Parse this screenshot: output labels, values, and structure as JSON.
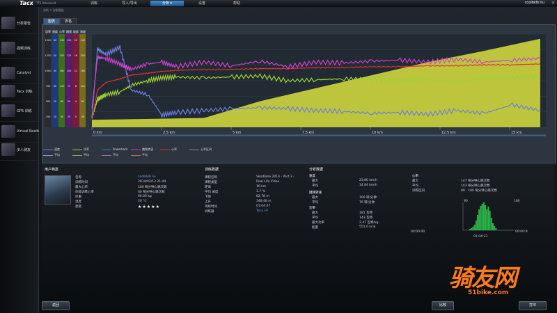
{
  "app": {
    "logo": "Tacx",
    "logo_sub": "TTS Advanced",
    "user": "coolbklb liu"
  },
  "menu": [
    {
      "label": "训练"
    },
    {
      "label": "导入/导出"
    },
    {
      "label": "分析"
    },
    {
      "label": "设置"
    },
    {
      "label": "帮助"
    }
  ],
  "sidebar": [
    {
      "label": "分析报告"
    },
    {
      "label": "视频训练"
    },
    {
      "label": "Catalyst"
    },
    {
      "label": "Tacx 训练"
    },
    {
      "label": "GPS 训练"
    },
    {
      "label": "Virtual Reality"
    },
    {
      "label": "多人骑友"
    }
  ],
  "breadcrumb": "分析 > 分析报告",
  "tabs": [
    {
      "label": "图表"
    },
    {
      "label": "表格"
    }
  ],
  "chart_data": {
    "type": "line",
    "x_ticks": [
      "0 km",
      "2.5 km",
      "5 km",
      "7.5 km",
      "10 km",
      "12.5 km",
      "15 km"
    ],
    "xlim": [
      0,
      16.2
    ],
    "y_axes": [
      {
        "name": "功率",
        "ticks": [
          "1500",
          "1250",
          "1000",
          "750",
          "500",
          "250"
        ]
      },
      {
        "name": "速度",
        "ticks": [
          "60",
          "50",
          "40",
          "30",
          "20",
          "10"
        ]
      },
      {
        "name": "心率",
        "ticks": [
          "240",
          "200",
          "160",
          "120",
          "80",
          "40"
        ]
      },
      {
        "name": "踏频",
        "ticks": [
          "150",
          "125",
          "100",
          "75",
          "50",
          "25"
        ]
      },
      {
        "name": "坡度",
        "ticks": [
          "20",
          "16",
          "12",
          "8",
          "4",
          "0"
        ]
      },
      {
        "name": "海拔",
        "ticks": [
          "240",
          "200",
          "160",
          "120",
          "80",
          "40"
        ]
      }
    ],
    "series": [
      {
        "name": "速度",
        "color": "#6b7fe0",
        "x": [
          0,
          0.2,
          0.5,
          1,
          1.4,
          2,
          2.5,
          3,
          4,
          5,
          6,
          7,
          8,
          9,
          10,
          11,
          12,
          13,
          14,
          15,
          16
        ],
        "y": [
          0.1,
          0.84,
          0.78,
          0.86,
          0.4,
          0.35,
          0.13,
          0.16,
          0.18,
          0.2,
          0.21,
          0.2,
          0.18,
          0.17,
          0.15,
          0.16,
          0.14,
          0.18,
          0.15,
          0.24,
          0.18
        ]
      },
      {
        "name": "功率",
        "color": "#9dd230",
        "x": [
          0,
          0.2,
          0.5,
          1,
          1.4,
          2,
          2.5,
          3,
          4,
          5,
          6,
          7,
          8,
          9,
          10,
          11,
          12,
          13,
          14,
          15,
          16
        ],
        "y": [
          0.1,
          0.3,
          0.35,
          0.38,
          0.45,
          0.5,
          0.53,
          0.54,
          0.53,
          0.54,
          0.55,
          0.5,
          0.51,
          0.52,
          0.52,
          0.5,
          0.51,
          0.49,
          0.52,
          0.53,
          0.55
        ]
      },
      {
        "name": "心率",
        "color": "#e03030",
        "x": [
          0,
          0.2,
          0.5,
          1,
          1.4,
          2,
          2.5,
          3,
          4,
          5,
          6,
          7,
          8,
          9,
          10,
          11,
          12,
          13,
          14,
          15,
          16
        ],
        "y": [
          0.08,
          0.4,
          0.48,
          0.52,
          0.56,
          0.58,
          0.6,
          0.61,
          0.62,
          0.62,
          0.63,
          0.63,
          0.64,
          0.64,
          0.65,
          0.65,
          0.66,
          0.66,
          0.67,
          0.67,
          0.68
        ]
      },
      {
        "name": "踏频",
        "color": "#d040d0",
        "x": [
          0,
          0.2,
          0.5,
          1,
          1.4,
          2,
          2.5,
          3,
          4,
          5,
          6,
          7,
          8,
          9,
          10,
          11,
          12,
          13,
          14,
          15,
          16
        ],
        "y": [
          0.2,
          0.75,
          0.74,
          0.68,
          0.62,
          0.68,
          0.7,
          0.65,
          0.7,
          0.66,
          0.71,
          0.65,
          0.7,
          0.69,
          0.71,
          0.72,
          0.7,
          0.73,
          0.7,
          0.72,
          0.74
        ]
      }
    ],
    "altitude_profile": {
      "x": [
        0,
        4,
        6,
        8,
        10,
        12,
        14,
        16
      ],
      "y": [
        0.08,
        0.1,
        0.28,
        0.42,
        0.56,
        0.7,
        0.82,
        0.95
      ],
      "color": "#d8e040"
    },
    "legend": [
      {
        "label": "速度",
        "color": "#6b7fe0"
      },
      {
        "label": "功率",
        "color": "#9dd230"
      },
      {
        "label": "Powerback",
        "color": "#5577aa"
      },
      {
        "label": "踏频转速",
        "color": "#d040d0"
      },
      {
        "label": "心率",
        "color": "#e03030"
      },
      {
        "label": "心率区间",
        "color": "#888888"
      },
      {
        "label": "平均",
        "color": "#8899cc"
      },
      {
        "label": "平均",
        "color": "#88aa66"
      },
      {
        "label": "平均",
        "color": "#aa66aa"
      },
      {
        "label": "平均",
        "color": "#cc6666"
      }
    ]
  },
  "user_info": {
    "title": "用户档案",
    "rows": [
      {
        "k": "名称",
        "v": "coolbklb liu",
        "link": true
      },
      {
        "k": "训练时间",
        "v": "2014/02/12 21:44"
      },
      {
        "k": "最大心率",
        "v": "180 每分钟心跳次数"
      },
      {
        "k": "体能训练心率",
        "v": "60 每分钟心跳次数"
      },
      {
        "k": "体重",
        "v": "60.00 kg"
      },
      {
        "k": "温度",
        "v": "20 °C"
      },
      {
        "k": "星级",
        "v": ""
      }
    ],
    "stars": "★★★★★"
  },
  "training_info": {
    "title": "训练数据",
    "rows": [
      {
        "k": "课程名称",
        "v": "Vendôme 2014 - Part 3 -"
      },
      {
        "k": "课程类型",
        "v": "Real Life Video"
      },
      {
        "k": "距离",
        "v": "16 km"
      },
      {
        "k": "平均 坡度",
        "v": "1.7 %"
      },
      {
        "k": "下降",
        "v": "82.78 m"
      },
      {
        "k": "上升",
        "v": "348.48 m"
      },
      {
        "k": "持续时间",
        "v": "01:04:47"
      },
      {
        "k": "训练器",
        "v": "Tacx i-V",
        "link": true
      }
    ]
  },
  "analysis": {
    "title": "分析数据",
    "speed": {
      "head": "速度",
      "rows": [
        {
          "k": "最大",
          "v": "23.80 km/h"
        },
        {
          "k": "平均",
          "v": "14.84 km/h"
        }
      ]
    },
    "cadence": {
      "head": "踏频转速",
      "rows": [
        {
          "k": "最大",
          "v": "100 转/分钟"
        },
        {
          "k": "平均",
          "v": "76 转/分钟"
        }
      ]
    },
    "power": {
      "head": "功率",
      "rows": [
        {
          "k": "最大",
          "v": "181 瓦特"
        },
        {
          "k": "平均",
          "v": "143 瓦特"
        },
        {
          "k": "最大功率",
          "v": "2.47 瓦特/kg"
        },
        {
          "k": "能量",
          "v": "551.0 kcal"
        }
      ]
    },
    "heart": {
      "head": "心率",
      "rows": [
        {
          "k": "最大",
          "v": "147 每分钟心跳次数"
        },
        {
          "k": "平均",
          "v": "103 每分钟心跳次数"
        },
        {
          "k": "训练区间",
          "v": "89 - 180 每分钟心跳次数"
        }
      ]
    },
    "hist_labels": {
      "left_top": "90",
      "right_top": "180",
      "left_bot": "00:00:00",
      "mid_bot": "01:04:23",
      "right_bot": "00:00:00"
    }
  },
  "buttons": {
    "left": "返回",
    "mid": "比较",
    "right": "打印"
  },
  "watermark": {
    "text": "骑友网",
    "url": "51bike.com"
  }
}
